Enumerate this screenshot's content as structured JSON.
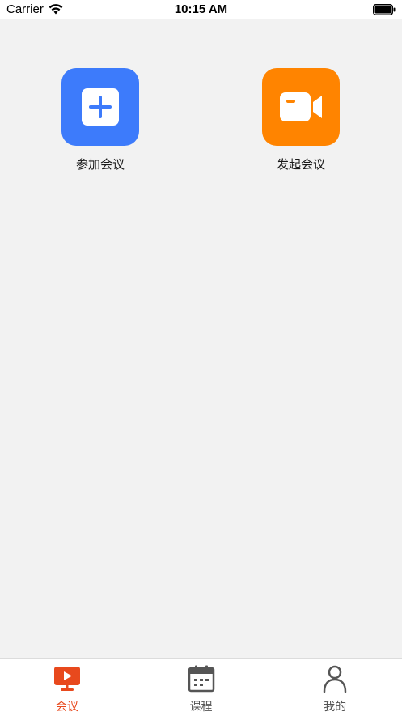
{
  "status_bar": {
    "carrier": "Carrier",
    "time": "10:15 AM"
  },
  "actions": {
    "join": {
      "label": "参加会议",
      "color": "#3d7bfb",
      "icon": "plus-square-icon"
    },
    "start": {
      "label": "发起会议",
      "color": "#ff8400",
      "icon": "video-camera-icon"
    }
  },
  "tabs": [
    {
      "label": "会议",
      "icon": "monitor-play-icon",
      "active": true
    },
    {
      "label": "课程",
      "icon": "calendar-icon",
      "active": false
    },
    {
      "label": "我的",
      "icon": "person-icon",
      "active": false
    }
  ],
  "colors": {
    "accent": "#e8491d",
    "inactive": "#555555",
    "background": "#f2f2f2"
  }
}
